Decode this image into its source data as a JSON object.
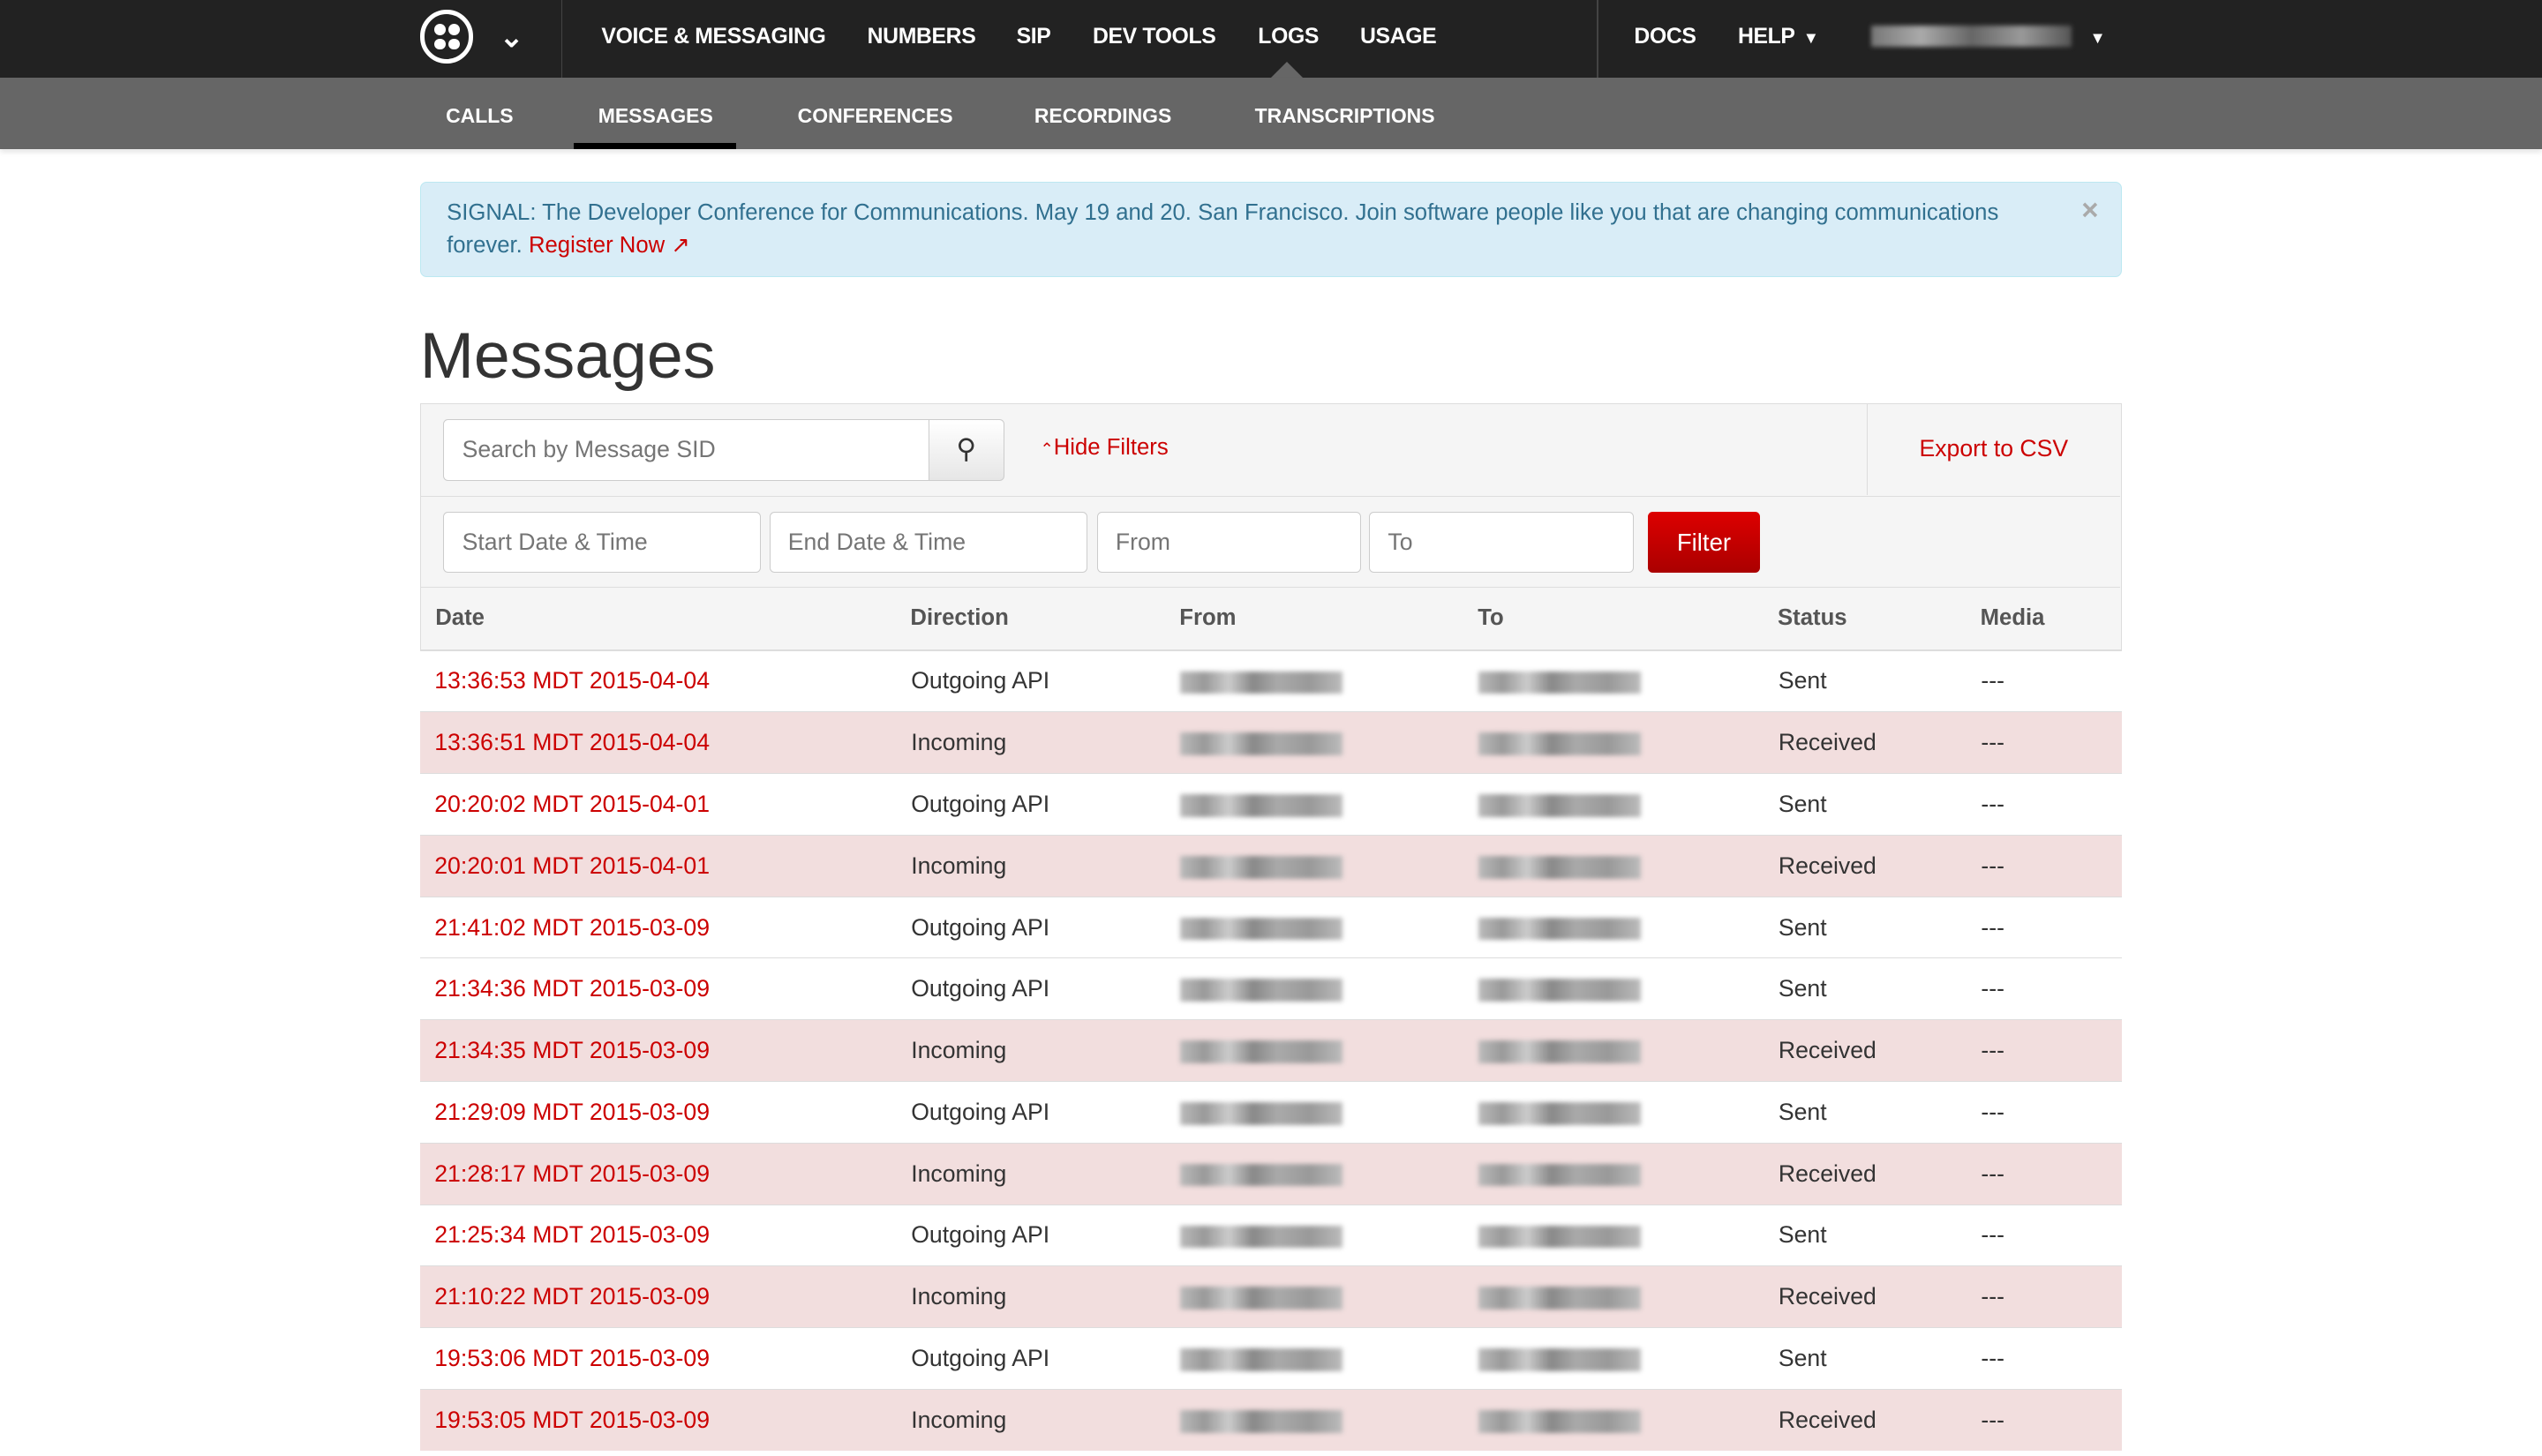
{
  "topnav": {
    "items": [
      "VOICE & MESSAGING",
      "NUMBERS",
      "SIP",
      "DEV TOOLS",
      "LOGS",
      "USAGE"
    ],
    "active": "LOGS",
    "docs": "DOCS",
    "help": "HELP",
    "icons": [
      "twilio-logo",
      "chevron-down-icon",
      "caret-down-icon"
    ]
  },
  "subnav": {
    "items": [
      "CALLS",
      "MESSAGES",
      "CONFERENCES",
      "RECORDINGS",
      "TRANSCRIPTIONS"
    ],
    "active": "MESSAGES"
  },
  "alert": {
    "text": "SIGNAL: The Developer Conference for Communications. May 19 and 20. San Francisco. Join software people like you that are changing communications forever.",
    "link": "Register Now",
    "close": "×"
  },
  "page": {
    "title": "Messages"
  },
  "filters": {
    "search_placeholder": "Search by Message SID",
    "hide_filters": "Hide Filters",
    "export": "Export to CSV",
    "start_placeholder": "Start Date & Time",
    "end_placeholder": "End Date & Time",
    "from_placeholder": "From",
    "to_placeholder": "To",
    "filter_button": "Filter"
  },
  "table": {
    "columns": [
      "Date",
      "Direction",
      "From",
      "To",
      "Status",
      "Media"
    ],
    "rows": [
      {
        "date": "13:36:53 MDT 2015-04-04",
        "direction": "Outgoing API",
        "status": "Sent",
        "media": "---"
      },
      {
        "date": "13:36:51 MDT 2015-04-04",
        "direction": "Incoming",
        "status": "Received",
        "media": "---"
      },
      {
        "date": "20:20:02 MDT 2015-04-01",
        "direction": "Outgoing API",
        "status": "Sent",
        "media": "---"
      },
      {
        "date": "20:20:01 MDT 2015-04-01",
        "direction": "Incoming",
        "status": "Received",
        "media": "---"
      },
      {
        "date": "21:41:02 MDT 2015-03-09",
        "direction": "Outgoing API",
        "status": "Sent",
        "media": "---"
      },
      {
        "date": "21:34:36 MDT 2015-03-09",
        "direction": "Outgoing API",
        "status": "Sent",
        "media": "---"
      },
      {
        "date": "21:34:35 MDT 2015-03-09",
        "direction": "Incoming",
        "status": "Received",
        "media": "---"
      },
      {
        "date": "21:29:09 MDT 2015-03-09",
        "direction": "Outgoing API",
        "status": "Sent",
        "media": "---"
      },
      {
        "date": "21:28:17 MDT 2015-03-09",
        "direction": "Incoming",
        "status": "Received",
        "media": "---"
      },
      {
        "date": "21:25:34 MDT 2015-03-09",
        "direction": "Outgoing API",
        "status": "Sent",
        "media": "---"
      },
      {
        "date": "21:10:22 MDT 2015-03-09",
        "direction": "Incoming",
        "status": "Received",
        "media": "---"
      },
      {
        "date": "19:53:06 MDT 2015-03-09",
        "direction": "Outgoing API",
        "status": "Sent",
        "media": "---"
      },
      {
        "date": "19:53:05 MDT 2015-03-09",
        "direction": "Incoming",
        "status": "Received",
        "media": "---"
      }
    ]
  },
  "colors": {
    "accent": "#cc0000",
    "incoming_row": "#f2dede",
    "topnav": "#222222",
    "subnav": "#666666",
    "alert_bg": "#d9edf7"
  }
}
